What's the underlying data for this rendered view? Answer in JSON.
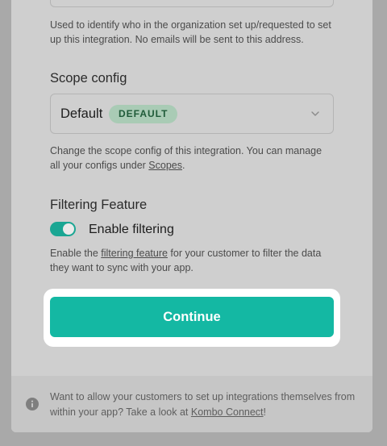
{
  "email_help": {
    "text": "Used to identify who in the organization set up/requested to set up this integration. No emails will be sent to this address."
  },
  "scope_config": {
    "title": "Scope config",
    "selected_value": "Default",
    "badge": "DEFAULT",
    "help_prefix": "Change the scope config of this integration. You can manage all your configs under ",
    "help_link": "Scopes",
    "help_suffix": "."
  },
  "filtering": {
    "title": "Filtering Feature",
    "toggle_label": "Enable filtering",
    "toggle_on": true,
    "help_prefix": "Enable the ",
    "help_link": "filtering feature",
    "help_suffix": " for your customer to filter the data they want to sync with your app."
  },
  "actions": {
    "continue_label": "Continue"
  },
  "footer": {
    "text_prefix": "Want to allow your customers to set up integrations themselves from within your app? Take a look at ",
    "link": "Kombo Connect",
    "text_suffix": "!"
  },
  "colors": {
    "accent": "#14b8a3",
    "toggle_on": "#1aa693",
    "badge_bg": "#a9cbb5",
    "badge_text": "#1f5b39",
    "overlay": "#a9a9a9"
  }
}
